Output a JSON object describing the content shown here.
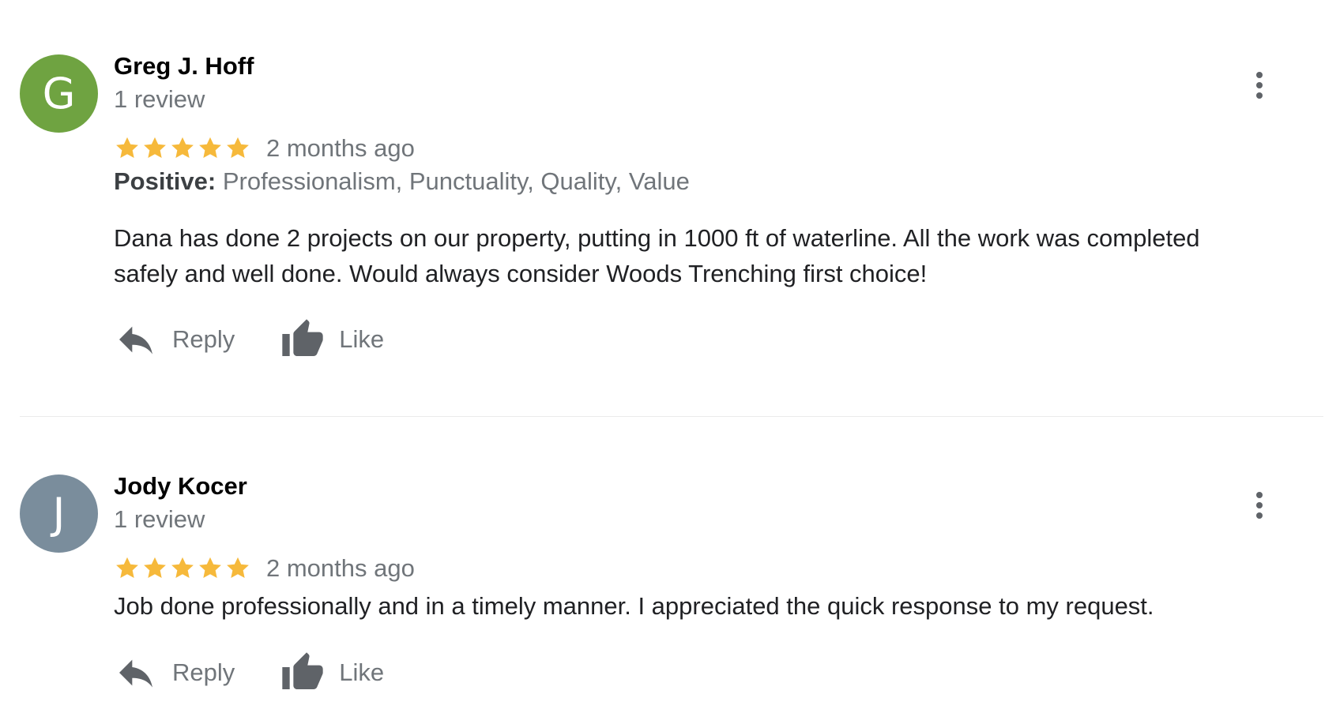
{
  "colors": {
    "star": "#F6B93B",
    "secondary_text": "#70757A",
    "icon": "#5F6368"
  },
  "reviews": [
    {
      "avatar_letter": "G",
      "avatar_color": "#6FA341",
      "name": "Greg J. Hoff",
      "review_count": "1 review",
      "rating": 5,
      "date": "2 months ago",
      "positive_label": "Positive:",
      "positive_values": "Professionalism, Punctuality, Quality, Value",
      "text": "Dana has done 2 projects on our property, putting in 1000 ft of waterline. All the work was completed safely and well done. Would always consider Woods Trenching first choice!",
      "reply_label": "Reply",
      "like_label": "Like"
    },
    {
      "avatar_letter": "J",
      "avatar_color": "#7A8D9C",
      "name": "Jody Kocer",
      "review_count": "1 review",
      "rating": 5,
      "date": "2 months ago",
      "text": "Job done professionally and in a timely manner. I appreciated the quick response to my request.",
      "reply_label": "Reply",
      "like_label": "Like"
    }
  ]
}
